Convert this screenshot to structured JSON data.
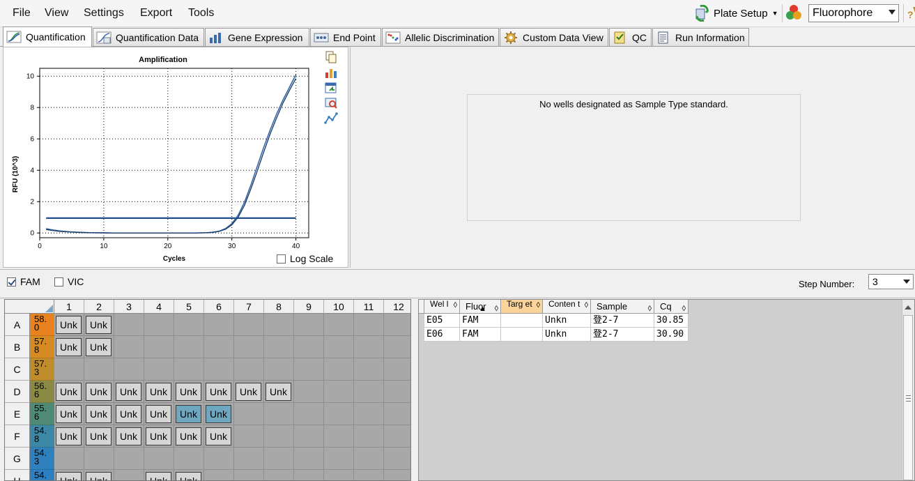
{
  "menu": [
    "File",
    "View",
    "Settings",
    "Export",
    "Tools"
  ],
  "toolbar": {
    "plate_setup_label": "Plate Setup",
    "fluorophore_value": "Fluorophore"
  },
  "tabs": [
    {
      "label": "Quantification",
      "active": true
    },
    {
      "label": "Quantification Data"
    },
    {
      "label": "Gene Expression"
    },
    {
      "label": "End Point"
    },
    {
      "label": "Allelic Discrimination"
    },
    {
      "label": "Custom Data View"
    },
    {
      "label": "QC"
    },
    {
      "label": "Run Information"
    }
  ],
  "standard_message": "No wells designated as Sample Type standard.",
  "log_scale_label": "Log Scale",
  "fluor_filters": [
    {
      "label": "FAM",
      "checked": true
    },
    {
      "label": "VIC",
      "checked": false
    }
  ],
  "step": {
    "label": "Step Number:",
    "value": "3"
  },
  "chart_data": {
    "type": "line",
    "title": "Amplification",
    "xlabel": "Cycles",
    "ylabel": "RFU (10^3)",
    "xlim": [
      0,
      42
    ],
    "ylim": [
      -0.3,
      10.5
    ],
    "xticks": [
      0,
      10,
      20,
      30,
      40
    ],
    "yticks": [
      0,
      2,
      4,
      6,
      8,
      10
    ],
    "grid": true,
    "threshold": 0.95,
    "x": [
      1,
      2,
      3,
      4,
      5,
      6,
      8,
      10,
      12,
      14,
      16,
      18,
      20,
      22,
      24,
      26,
      27,
      28,
      29,
      30,
      31,
      32,
      33,
      34,
      35,
      36,
      37,
      38,
      39,
      40
    ],
    "series": [
      {
        "values": [
          0.28,
          0.2,
          0.14,
          0.1,
          0.07,
          0.05,
          0.02,
          0.01,
          0.0,
          0.0,
          0.0,
          0.0,
          0.0,
          0.0,
          0.0,
          0.02,
          0.05,
          0.12,
          0.28,
          0.6,
          1.15,
          2.0,
          3.1,
          4.3,
          5.5,
          6.6,
          7.6,
          8.5,
          9.3,
          10.1
        ]
      },
      {
        "values": [
          0.22,
          0.16,
          0.11,
          0.08,
          0.06,
          0.04,
          0.02,
          0.01,
          0.0,
          0.0,
          0.0,
          0.0,
          0.0,
          0.0,
          0.0,
          0.02,
          0.04,
          0.1,
          0.24,
          0.52,
          1.02,
          1.8,
          2.85,
          4.0,
          5.2,
          6.35,
          7.35,
          8.3,
          9.1,
          9.85
        ]
      }
    ]
  },
  "plate": {
    "columns": [
      "1",
      "2",
      "3",
      "4",
      "5",
      "6",
      "7",
      "8",
      "9",
      "10",
      "11",
      "12"
    ],
    "rows": [
      {
        "label": "A",
        "temp": "58.0"
      },
      {
        "label": "B",
        "temp": "57.8"
      },
      {
        "label": "C",
        "temp": "57.3"
      },
      {
        "label": "D",
        "temp": "56.6"
      },
      {
        "label": "E",
        "temp": "55.6"
      },
      {
        "label": "F",
        "temp": "54.8"
      },
      {
        "label": "G",
        "temp": "54.3"
      },
      {
        "label": "H",
        "temp": "54."
      }
    ],
    "temp_colors": [
      "#e8821e",
      "#d68a22",
      "#bf8c2c",
      "#8a8a44",
      "#4e8a76",
      "#3c86a6",
      "#2f80bd",
      "#2e7fc2"
    ],
    "wells": [
      {
        "row": 0,
        "col": 0,
        "label": "Unk"
      },
      {
        "row": 0,
        "col": 1,
        "label": "Unk"
      },
      {
        "row": 1,
        "col": 0,
        "label": "Unk"
      },
      {
        "row": 1,
        "col": 1,
        "label": "Unk"
      },
      {
        "row": 3,
        "col": 0,
        "label": "Unk"
      },
      {
        "row": 3,
        "col": 1,
        "label": "Unk"
      },
      {
        "row": 3,
        "col": 2,
        "label": "Unk"
      },
      {
        "row": 3,
        "col": 3,
        "label": "Unk"
      },
      {
        "row": 3,
        "col": 4,
        "label": "Unk"
      },
      {
        "row": 3,
        "col": 5,
        "label": "Unk"
      },
      {
        "row": 3,
        "col": 6,
        "label": "Unk"
      },
      {
        "row": 3,
        "col": 7,
        "label": "Unk"
      },
      {
        "row": 4,
        "col": 0,
        "label": "Unk"
      },
      {
        "row": 4,
        "col": 1,
        "label": "Unk"
      },
      {
        "row": 4,
        "col": 2,
        "label": "Unk"
      },
      {
        "row": 4,
        "col": 3,
        "label": "Unk"
      },
      {
        "row": 4,
        "col": 4,
        "label": "Unk",
        "selected": true
      },
      {
        "row": 4,
        "col": 5,
        "label": "Unk",
        "selected": true
      },
      {
        "row": 5,
        "col": 0,
        "label": "Unk"
      },
      {
        "row": 5,
        "col": 1,
        "label": "Unk"
      },
      {
        "row": 5,
        "col": 2,
        "label": "Unk"
      },
      {
        "row": 5,
        "col": 3,
        "label": "Unk"
      },
      {
        "row": 5,
        "col": 4,
        "label": "Unk"
      },
      {
        "row": 5,
        "col": 5,
        "label": "Unk"
      },
      {
        "row": 7,
        "col": 0,
        "label": "Unk"
      },
      {
        "row": 7,
        "col": 1,
        "label": "Unk"
      },
      {
        "row": 7,
        "col": 3,
        "label": "Unk"
      },
      {
        "row": 7,
        "col": 4,
        "label": "Unk"
      }
    ]
  },
  "well_table": {
    "columns": [
      {
        "label": "Wel l",
        "tight": true
      },
      {
        "label": "Fluor",
        "sort": "▲"
      },
      {
        "label": "Targ et",
        "tight": true,
        "sorted": true
      },
      {
        "label": "Conten t",
        "tight": true
      },
      {
        "label": "Sample"
      },
      {
        "label": "Cq"
      }
    ],
    "rows": [
      [
        "E05",
        "FAM",
        "",
        "Unkn",
        "登2-7",
        "30.85"
      ],
      [
        "E06",
        "FAM",
        "",
        "Unkn",
        "登2-7",
        "30.90"
      ]
    ]
  }
}
